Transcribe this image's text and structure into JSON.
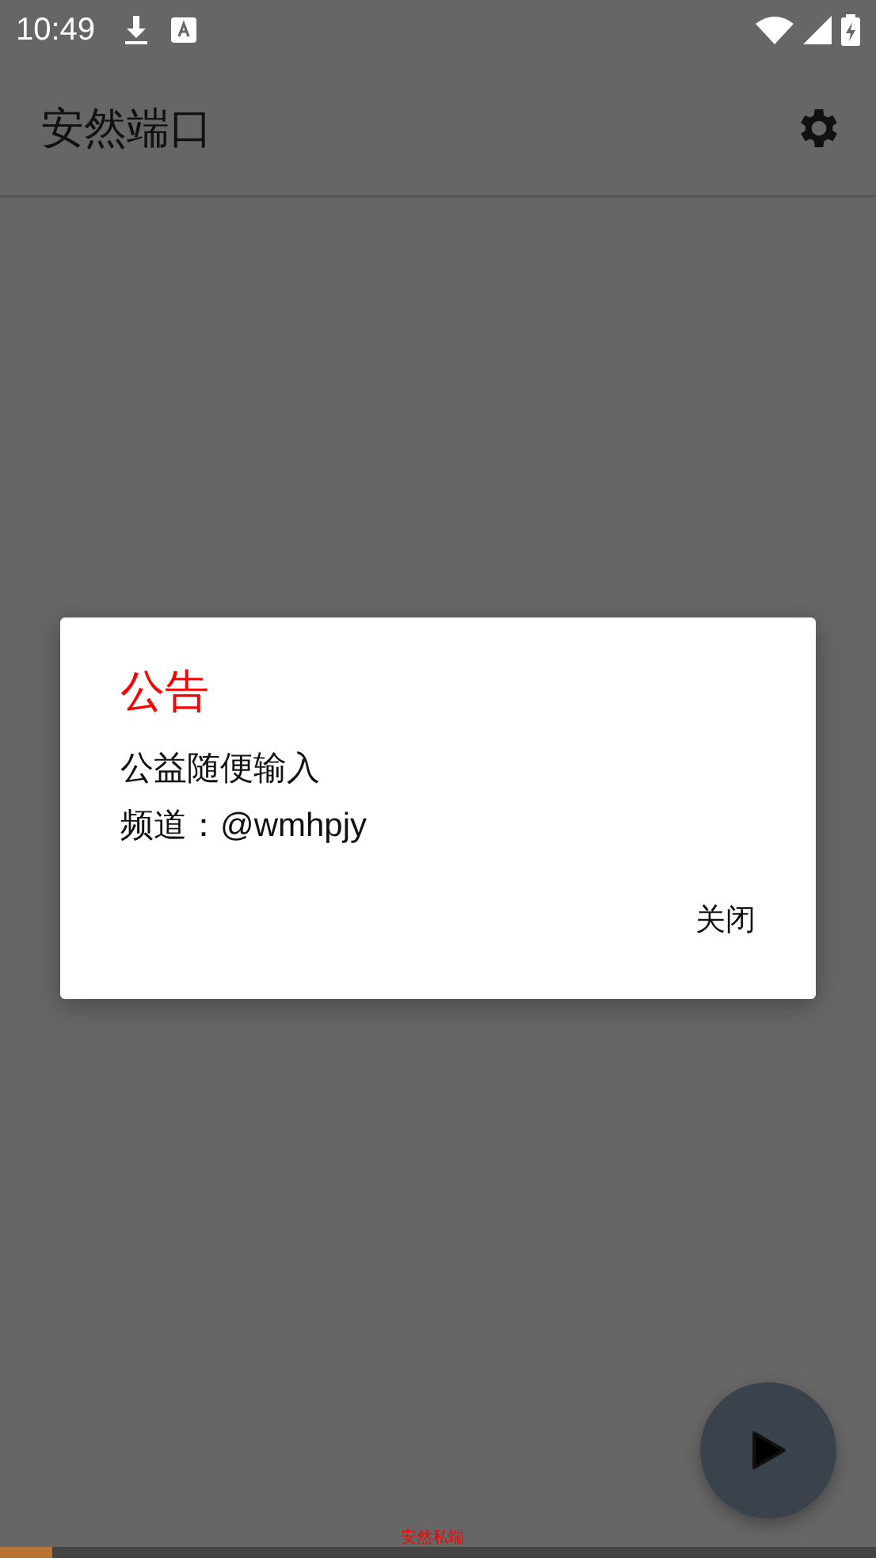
{
  "status_bar": {
    "time": "10:49"
  },
  "app_bar": {
    "title": "安然端口"
  },
  "dialog": {
    "title": "公告",
    "lines": [
      "公益随便输入",
      "频道：@wmhpjy"
    ],
    "button": "关闭"
  },
  "footer": {
    "label": "安然私端"
  },
  "progress": {
    "level": 0.06
  }
}
